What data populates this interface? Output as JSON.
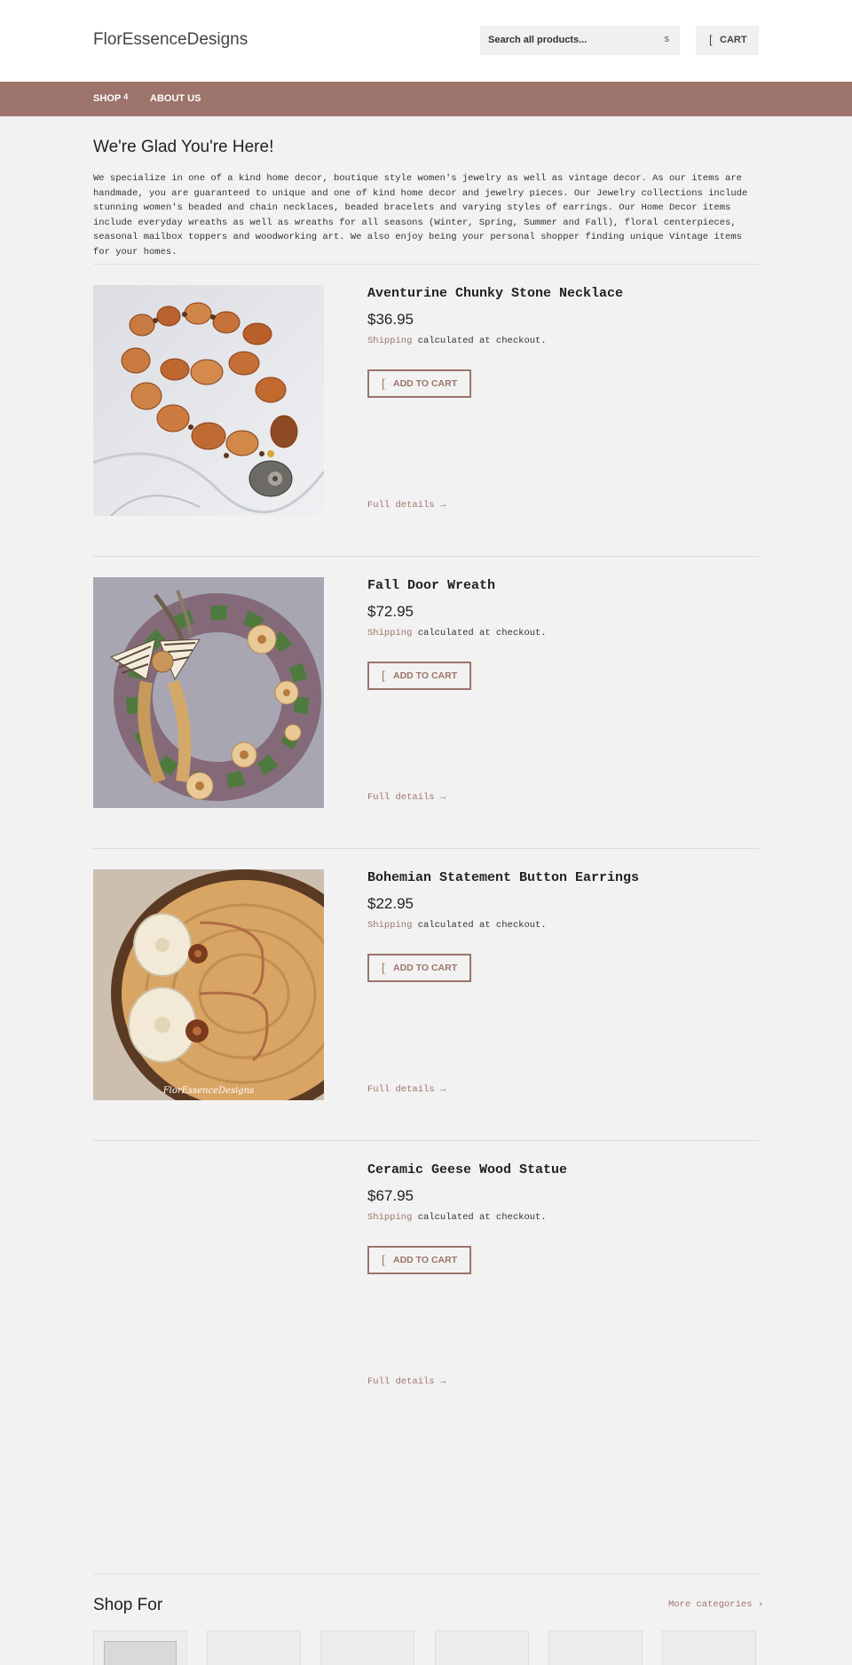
{
  "header": {
    "logo": "FlorEssenceDesigns",
    "search_placeholder": "Search all products...",
    "search_icon_glyph": "s",
    "cart_icon_glyph": "[",
    "cart_label": "CART"
  },
  "nav": {
    "items": [
      {
        "label": "SHOP",
        "caret": "4"
      },
      {
        "label": "ABOUT US"
      }
    ]
  },
  "intro": {
    "title": "We're Glad You're Here!",
    "text": "We specialize in one of a kind home decor, boutique style women's jewelry as well as vintage decor. As our items are handmade, you are guaranteed to unique and one of kind home decor and jewelry pieces. Our Jewelry collections include stunning women's beaded and chain necklaces, beaded bracelets and varying styles of earrings. Our Home Decor items include everyday wreaths as well as wreaths for all seasons (Winter, Spring, Summer and Fall), floral centerpieces, seasonal mailbox toppers and woodworking art. We also enjoy being your personal shopper finding unique Vintage items for your homes."
  },
  "products": [
    {
      "title": "Aventurine Chunky Stone Necklace",
      "price": "$36.95",
      "shipping_link": "Shipping",
      "shipping_rest": " calculated at checkout.",
      "atc_icon": "[",
      "atc_label": "ADD TO CART",
      "details": "Full details →"
    },
    {
      "title": "Fall Door Wreath",
      "price": "$72.95",
      "shipping_link": "Shipping",
      "shipping_rest": " calculated at checkout.",
      "atc_icon": "[",
      "atc_label": "ADD TO CART",
      "details": "Full details →"
    },
    {
      "title": "Bohemian Statement Button Earrings",
      "price": "$22.95",
      "shipping_link": "Shipping",
      "shipping_rest": " calculated at checkout.",
      "atc_icon": "[",
      "atc_label": "ADD TO CART",
      "details": "Full details →",
      "watermark": "FlorEssenceDesigns"
    },
    {
      "title": "Ceramic Geese Wood Statue",
      "price": "$67.95",
      "shipping_link": "Shipping",
      "shipping_rest": " calculated at checkout.",
      "atc_icon": "[",
      "atc_label": "ADD TO CART",
      "details": "Full details →"
    }
  ],
  "shop_for": {
    "title": "Shop For",
    "more_link": "More categories ›"
  },
  "colors": {
    "accent": "#9c746b",
    "background": "#f2f2f2"
  }
}
